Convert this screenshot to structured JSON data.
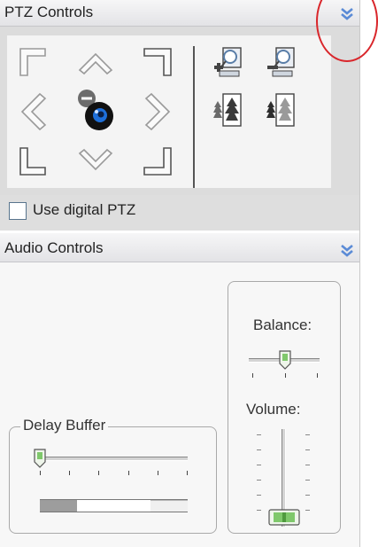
{
  "ptz": {
    "title": "PTZ Controls",
    "collapse_icon": "double-chevron-down-icon",
    "pan_buttons": [
      {
        "name": "pan-up-left-button",
        "icon": "corner-up-left-icon"
      },
      {
        "name": "pan-up-button",
        "icon": "chevron-up-icon"
      },
      {
        "name": "pan-up-right-button",
        "icon": "corner-up-right-icon"
      },
      {
        "name": "pan-left-button",
        "icon": "chevron-left-icon"
      },
      {
        "name": "home-button",
        "icon": "camera-home-icon"
      },
      {
        "name": "pan-right-button",
        "icon": "chevron-right-icon"
      },
      {
        "name": "pan-down-left-button",
        "icon": "corner-down-left-icon"
      },
      {
        "name": "pan-down-button",
        "icon": "chevron-down-icon"
      },
      {
        "name": "pan-down-right-button",
        "icon": "corner-down-right-icon"
      }
    ],
    "zoom_buttons": [
      {
        "name": "zoom-in-button",
        "icon": "zoom-in-icon"
      },
      {
        "name": "zoom-out-button",
        "icon": "zoom-out-icon"
      },
      {
        "name": "focus-near-button",
        "icon": "focus-near-icon"
      },
      {
        "name": "focus-far-button",
        "icon": "focus-far-icon"
      }
    ],
    "digital_ptz_label": "Use digital PTZ",
    "digital_ptz_checked": false
  },
  "audio": {
    "title": "Audio Controls",
    "collapse_icon": "double-chevron-down-icon",
    "delay_buffer_label": "Delay Buffer",
    "delay_buffer_value": 0.0,
    "buffer_fill_level": 0.25,
    "balance_label": "Balance:",
    "balance_value": 0.5,
    "volume_label": "Volume:",
    "volume_value": 0.0
  },
  "colors": {
    "accent_chevron": "#5b8bd6",
    "annotation_circle": "#d9262b",
    "slider_thumb": "#6fbf5a"
  }
}
